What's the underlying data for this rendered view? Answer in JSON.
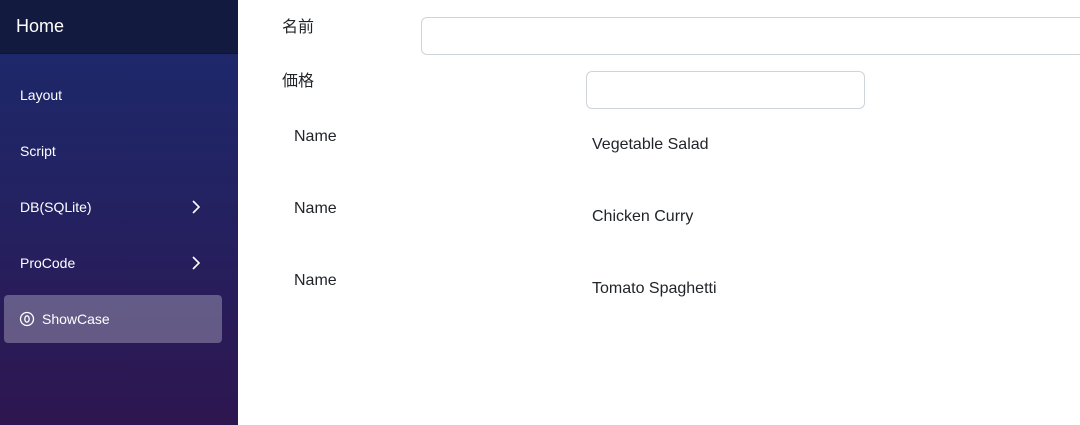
{
  "sidebar": {
    "brand": "Home",
    "items": [
      {
        "label": "Layout",
        "has_chevron": false
      },
      {
        "label": "Script",
        "has_chevron": false
      },
      {
        "label": "DB(SQLite)",
        "has_chevron": true
      },
      {
        "label": "ProCode",
        "has_chevron": true
      },
      {
        "label": "ShowCase",
        "active": true,
        "icon": "radio-circle-icon"
      }
    ]
  },
  "form": {
    "name_label": "名前",
    "name_value": "",
    "price_label": "価格",
    "price_value": ""
  },
  "list": {
    "rows": [
      {
        "label": "Name",
        "value": "Vegetable Salad"
      },
      {
        "label": "Name",
        "value": "Chicken Curry"
      },
      {
        "label": "Name",
        "value": "Tomato Spaghetti"
      }
    ]
  },
  "colors": {
    "sidebar_top": "#1b2a6d",
    "sidebar_bottom": "#2e1650",
    "header_bg": "#121a3f",
    "text": "#212529",
    "input_border": "#ced4da"
  }
}
